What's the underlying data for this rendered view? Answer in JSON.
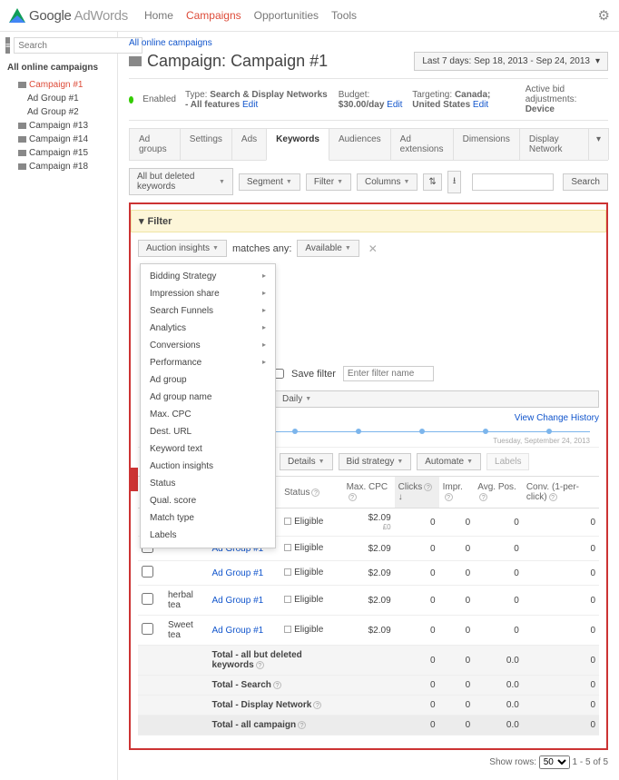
{
  "header": {
    "logo_text": "Google AdWords",
    "nav": [
      "Home",
      "Campaigns",
      "Opportunities",
      "Tools"
    ],
    "active_nav": "Campaigns"
  },
  "sidebar": {
    "search_placeholder": "Search",
    "heading": "All online campaigns",
    "tree": [
      {
        "label": "Campaign #1",
        "active": true,
        "lv": 1
      },
      {
        "label": "Ad Group #1",
        "lv": 2
      },
      {
        "label": "Ad Group #2",
        "lv": 2
      },
      {
        "label": "Campaign #13",
        "lv": 1
      },
      {
        "label": "Campaign #14",
        "lv": 1
      },
      {
        "label": "Campaign #15",
        "lv": 1
      },
      {
        "label": "Campaign #18",
        "lv": 1
      }
    ]
  },
  "breadcrumb": "All online campaigns",
  "title_prefix": "Campaign:",
  "title": "Campaign #1",
  "daterange": "Last 7 days: Sep 18, 2013 - Sep 24, 2013",
  "status": {
    "state": "Enabled",
    "type_label": "Type:",
    "type": "Search & Display Networks - All features",
    "budget_label": "Budget:",
    "budget": "$30.00/day",
    "target_label": "Targeting:",
    "target": "Canada; United States",
    "bid_label": "Active bid adjustments:",
    "bid": "Device",
    "edit": "Edit"
  },
  "tabs": [
    "Ad groups",
    "Settings",
    "Ads",
    "Keywords",
    "Audiences",
    "Ad extensions",
    "Dimensions",
    "Display Network"
  ],
  "active_tab": "Keywords",
  "toolbar": {
    "keywords_filter": "All but deleted keywords",
    "segment": "Segment",
    "filter": "Filter",
    "columns": "Columns",
    "search": "Search"
  },
  "filter_panel": {
    "title": "Filter",
    "selector": "Auction insights",
    "matches": "matches any:",
    "available": "Available",
    "dropdown": [
      "Bidding Strategy",
      "Impression share",
      "Search Funnels",
      "Analytics",
      "Conversions",
      "Performance",
      "Ad group",
      "Ad group name",
      "Max. CPC",
      "Dest. URL",
      "Keyword text",
      "Auction insights",
      "Status",
      "Qual. score",
      "Match type",
      "Labels"
    ],
    "dropdown_sub": [
      true,
      true,
      true,
      true,
      true,
      true,
      false,
      false,
      false,
      false,
      false,
      false,
      false,
      false,
      false,
      false
    ],
    "save_label": "Save filter",
    "save_placeholder": "Enter filter name",
    "daily": "Daily",
    "view_history": "View Change History"
  },
  "chart": {
    "date": "Tuesday, September 24, 2013"
  },
  "table_btns": {
    "details": "Details",
    "bid": "Bid strategy",
    "automate": "Automate",
    "labels": "Labels"
  },
  "columns": [
    "",
    "",
    "Ad group",
    "Status",
    "Max. CPC",
    "Clicks",
    "Impr.",
    "Avg. Pos.",
    "Conv. (1-per-click)"
  ],
  "sorted_col": "Clicks",
  "rows": [
    {
      "kw": "",
      "ag": "Ad Group #1",
      "status": "Eligible",
      "cpc": "$2.09",
      "clicks": "0",
      "impr": "0",
      "pos": "0",
      "conv": "0",
      "sub": "£0"
    },
    {
      "kw": "",
      "ag": "Ad Group #1",
      "status": "Eligible",
      "cpc": "$2.09",
      "clicks": "0",
      "impr": "0",
      "pos": "0",
      "conv": "0"
    },
    {
      "kw": "",
      "ag": "Ad Group #1",
      "status": "Eligible",
      "cpc": "$2.09",
      "clicks": "0",
      "impr": "0",
      "pos": "0",
      "conv": "0"
    },
    {
      "kw": "herbal tea",
      "ag": "Ad Group #1",
      "status": "Eligible",
      "cpc": "$2.09",
      "clicks": "0",
      "impr": "0",
      "pos": "0",
      "conv": "0"
    },
    {
      "kw": "Sweet tea",
      "ag": "Ad Group #1",
      "status": "Eligible",
      "cpc": "$2.09",
      "clicks": "0",
      "impr": "0",
      "pos": "0",
      "conv": "0"
    }
  ],
  "totals": [
    {
      "label": "Total - all but deleted keywords",
      "clicks": "0",
      "impr": "0",
      "pos": "0.0",
      "conv": "0"
    },
    {
      "label": "Total - Search",
      "clicks": "0",
      "impr": "0",
      "pos": "0.0",
      "conv": "0"
    },
    {
      "label": "Total - Display Network",
      "clicks": "0",
      "impr": "0",
      "pos": "0.0",
      "conv": "0"
    },
    {
      "label": "Total - all campaign",
      "clicks": "0",
      "impr": "0",
      "pos": "0.0",
      "conv": "0"
    }
  ],
  "pager": {
    "show_rows": "Show rows:",
    "value": "50",
    "range": "1 - 5 of 5"
  }
}
